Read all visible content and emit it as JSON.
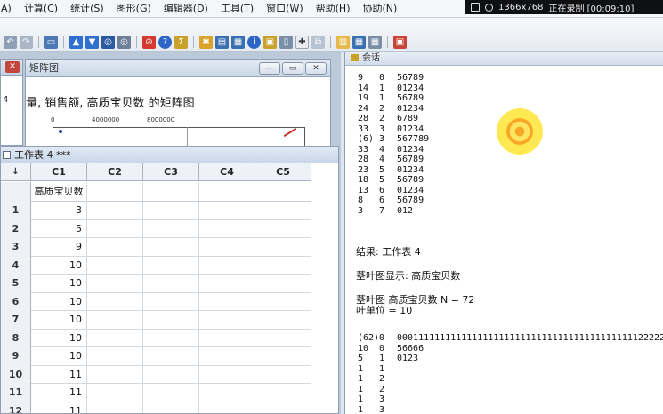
{
  "menubar": {
    "items": [
      "A)",
      "计算(C)",
      "统计(S)",
      "图形(G)",
      "编辑器(D)",
      "工具(T)",
      "窗口(W)",
      "帮助(H)",
      "协助(N)"
    ]
  },
  "recorder": {
    "resolution": "1366x768",
    "status": "正在录制 [00:09:10]"
  },
  "mini_window": {
    "label": "4"
  },
  "plot_window": {
    "title": "矩阵图",
    "caption": "量, 销售额, 高质宝贝数 的矩阵图",
    "ticks": [
      "0",
      "4000000",
      "8000000"
    ]
  },
  "worksheet": {
    "title": "工作表 4 ***",
    "corner": "↓",
    "columns": [
      "C1",
      "C2",
      "C3",
      "C4",
      "C5"
    ],
    "names": [
      "高质宝贝数",
      "",
      "",
      "",
      ""
    ],
    "rows": [
      {
        "n": "1",
        "v": "3"
      },
      {
        "n": "2",
        "v": "5"
      },
      {
        "n": "3",
        "v": "9"
      },
      {
        "n": "4",
        "v": "10"
      },
      {
        "n": "5",
        "v": "10"
      },
      {
        "n": "6",
        "v": "10"
      },
      {
        "n": "7",
        "v": "10"
      },
      {
        "n": "8",
        "v": "10"
      },
      {
        "n": "9",
        "v": "10"
      },
      {
        "n": "10",
        "v": "11"
      },
      {
        "n": "11",
        "v": "11"
      },
      {
        "n": "12",
        "v": "11"
      }
    ]
  },
  "session": {
    "title": "会话",
    "stem_lines": [
      [
        "9",
        "0",
        "56789"
      ],
      [
        "14",
        "1",
        "01234"
      ],
      [
        "19",
        "1",
        "56789"
      ],
      [
        "24",
        "2",
        "01234"
      ],
      [
        "28",
        "2",
        "6789"
      ],
      [
        "33",
        "3",
        "01234"
      ],
      [
        "(6)",
        "3",
        "567789"
      ],
      [
        "33",
        "4",
        "01234"
      ],
      [
        "28",
        "4",
        "56789"
      ],
      [
        "23",
        "5",
        "01234"
      ],
      [
        "18",
        "5",
        "56789"
      ],
      [
        "13",
        "6",
        "01234"
      ],
      [
        "8",
        "6",
        "56789"
      ],
      [
        "3",
        "7",
        "012"
      ]
    ],
    "result_label": "结果: 工作表 4",
    "display_label": "茎叶图显示: 高质宝贝数",
    "plot_header": "茎叶图 高质宝贝数  N = 72",
    "leaf_unit": "叶单位 = 10",
    "stem_lines_2": [
      [
        "(62)",
        "0",
        "0001111111111111111111111111111111111111111112222222"
      ],
      [
        "10",
        "0",
        "56666"
      ],
      [
        "5",
        "1",
        "0123"
      ],
      [
        "1",
        "1",
        ""
      ],
      [
        "1",
        "2",
        ""
      ],
      [
        "1",
        "2",
        ""
      ],
      [
        "1",
        "3",
        ""
      ],
      [
        "1",
        "3",
        ""
      ]
    ]
  }
}
